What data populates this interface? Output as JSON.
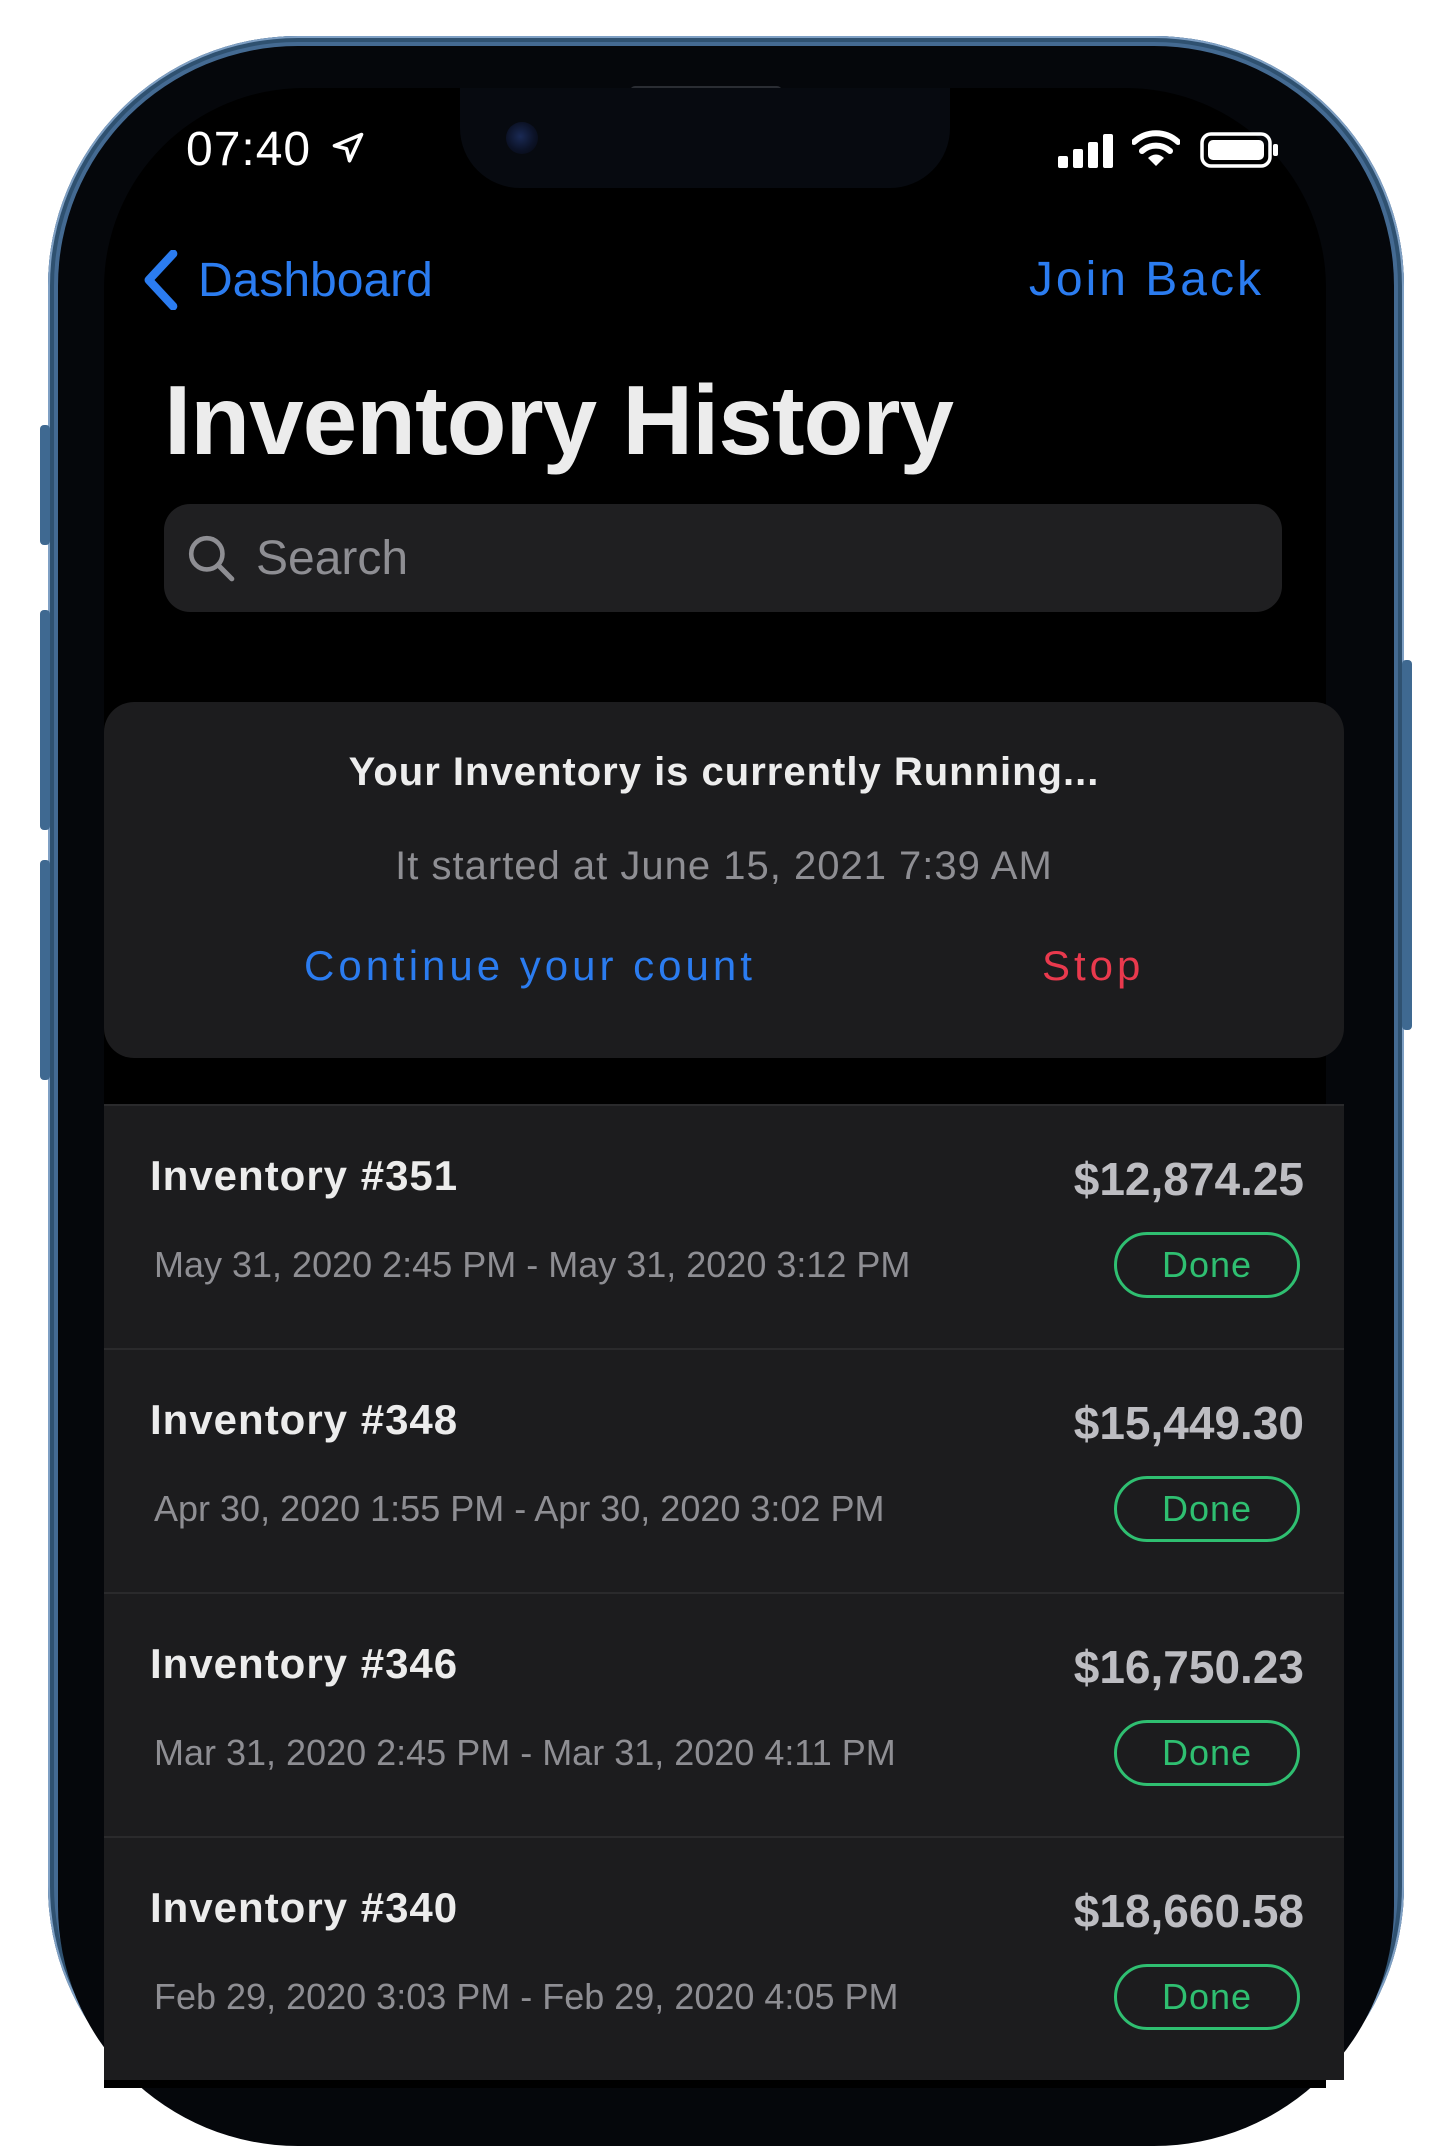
{
  "status_bar": {
    "time": "07:40"
  },
  "nav": {
    "back_label": "Dashboard",
    "right_action": "Join Back"
  },
  "page": {
    "title": "Inventory History"
  },
  "search": {
    "placeholder": "Search"
  },
  "running": {
    "title": "Your Inventory is currently Running...",
    "subtitle": "It started at June 15, 2021 7:39 AM",
    "continue_label": "Continue your count",
    "stop_label": "Stop"
  },
  "history": [
    {
      "name": "Inventory #351",
      "amount": "$12,874.25",
      "dates": "May 31, 2020 2:45 PM - May 31, 2020 3:12 PM",
      "status": "Done"
    },
    {
      "name": "Inventory #348",
      "amount": "$15,449.30",
      "dates": "Apr 30, 2020 1:55 PM - Apr 30, 2020 3:02 PM",
      "status": "Done"
    },
    {
      "name": "Inventory #346",
      "amount": "$16,750.23",
      "dates": "Mar 31, 2020 2:45 PM - Mar 31, 2020 4:11 PM",
      "status": "Done"
    },
    {
      "name": "Inventory #340",
      "amount": "$18,660.58",
      "dates": "Feb 29, 2020 3:03 PM - Feb 29, 2020 4:05 PM",
      "status": "Done"
    }
  ],
  "colors": {
    "accent": "#2b7cf0",
    "danger": "#e9394d",
    "success": "#2fbf71"
  }
}
